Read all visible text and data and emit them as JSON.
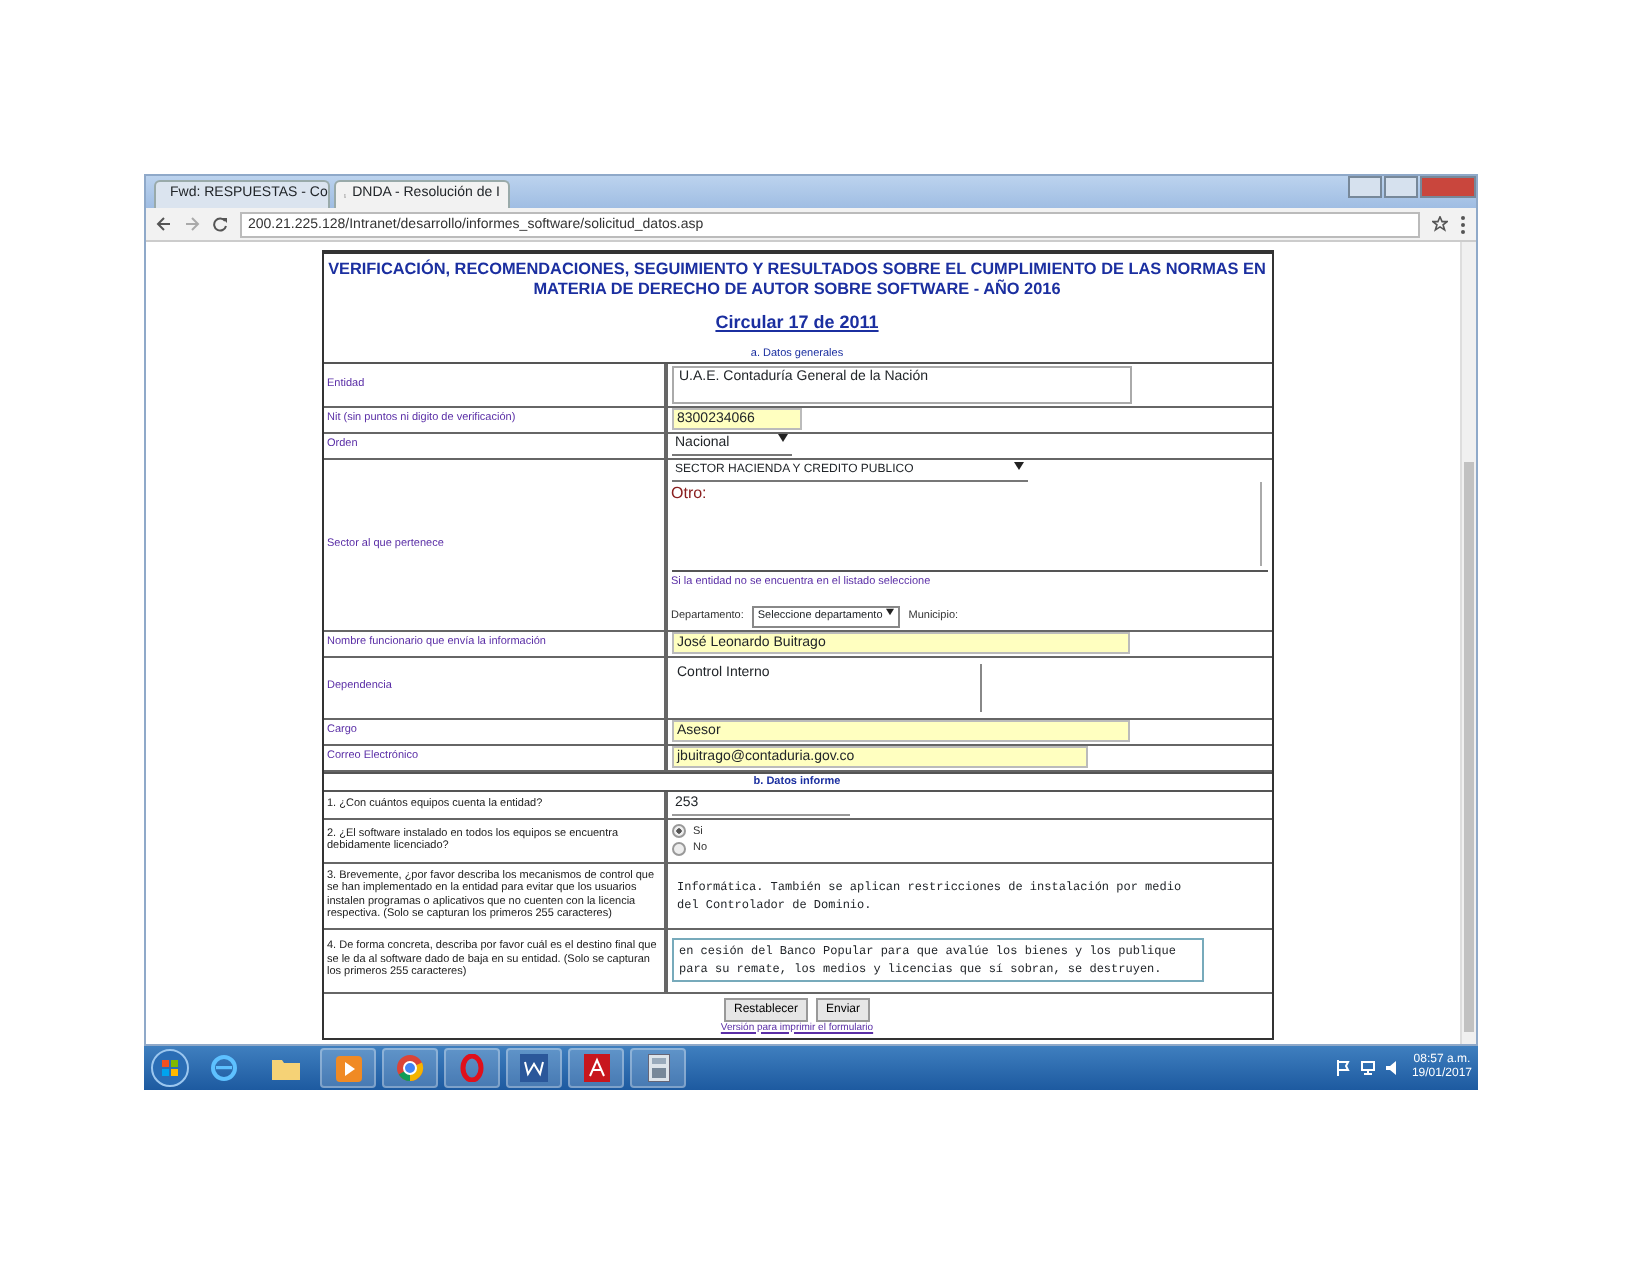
{
  "browser": {
    "tabs": [
      {
        "title": "Fwd: RESPUESTAS - Co",
        "selected": false
      },
      {
        "title": "DNDA - Resolución de I",
        "selected": true
      }
    ],
    "url": "200.21.225.128/Intranet/desarrollo/informes_software/solicitud_datos.asp"
  },
  "form": {
    "title": "VERIFICACIÓN, RECOMENDACIONES, SEGUIMIENTO Y RESULTADOS SOBRE EL CUMPLIMIENTO DE LAS NORMAS EN MATERIA DE DERECHO DE AUTOR SOBRE SOFTWARE - AÑO 2016",
    "circular": "Circular 17 de 2011",
    "sections": [
      {
        "heading": "a. Datos generales",
        "rows": [
          {
            "kind": "textarea",
            "label": "Entidad",
            "value": "U.A.E. Contaduría General de la Nación",
            "highlighted": false
          },
          {
            "kind": "input",
            "label": "Nit (sin puntos ni digito de verificación)",
            "value": "8300234066",
            "highlighted": true
          },
          {
            "kind": "select",
            "label": "Orden",
            "value": "Nacional"
          },
          {
            "kind": "sector",
            "label": "Sector al que pertenece",
            "value": "SECTOR HACIENDA Y CREDITO PUBLICO",
            "other": "Otro:",
            "note": "Si la entidad no se encuentra en el listado seleccione",
            "department_label": "Departamento:",
            "department": "Seleccione departamento",
            "municipality_label": "Municipio:"
          },
          {
            "kind": "input",
            "label": "Nombre funcionario que envía la información",
            "value": "José Leonardo Buitrago",
            "highlighted": true
          },
          {
            "kind": "textarea",
            "label": "Dependencia",
            "value": "Control Interno",
            "highlighted": false
          },
          {
            "kind": "input",
            "label": "Cargo",
            "value": "Asesor",
            "highlighted": true
          },
          {
            "kind": "input",
            "label": "Correo Electrónico",
            "value": "jbuitrago@contaduria.gov.co",
            "highlighted": true
          }
        ]
      },
      {
        "heading": "b. Datos informe",
        "rows": [
          {
            "kind": "input",
            "label": "1. ¿Con cuántos equipos cuenta la entidad?",
            "value": "253",
            "highlighted": false
          },
          {
            "kind": "radio",
            "label": "2. ¿El software instalado en todos los equipos se encuentra debidamente licenciado?",
            "options": [
              {
                "label": "Si",
                "selected": true
              },
              {
                "label": "No",
                "selected": false
              }
            ]
          },
          {
            "kind": "textarea",
            "label": "3. Brevemente, ¿por favor describa los mecanismos de control que se han implementado en la entidad para evitar que los usuarios instalen programas o aplicativos que no cuenten con la licencia respectiva. (Solo se capturan los primeros 255 caracteres)",
            "value": "Informática. También se aplican restricciones de instalación por medio del Controlador de Dominio.",
            "highlighted": false
          },
          {
            "kind": "textarea",
            "label": "4. De forma concreta, describa por favor cuál es el destino final que se le da al software dado de baja en su entidad. (Solo se capturan los primeros 255 caracteres)",
            "value": "en cesión del Banco Popular para que avalúe los bienes y los publique para su remate, los medios y licencias que sí sobran, se destruyen.",
            "highlighted": false
          }
        ]
      }
    ],
    "buttons": [
      "Restablecer",
      "Enviar"
    ],
    "footer_link": "Versión para imprimir el formulario"
  },
  "taskbar": {
    "time": "08:57 a.m.",
    "date": "19/01/2017"
  }
}
